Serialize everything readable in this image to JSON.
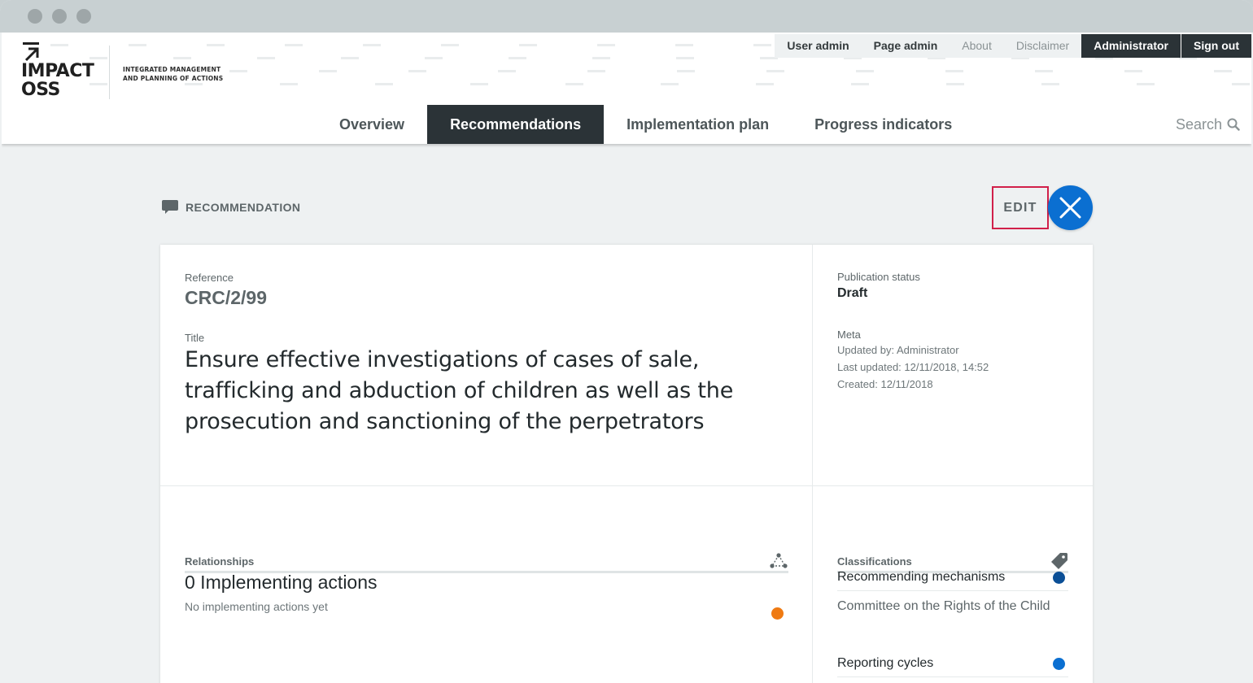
{
  "window": {
    "controls": [
      "close",
      "minimize",
      "maximize"
    ]
  },
  "header": {
    "logo": {
      "name": "IMPACT\nOSS",
      "claim_line1": "INTEGRATED MANAGEMENT",
      "claim_line2": "AND PLANNING OF ACTIONS",
      "icon": "arrow-up-left-icon"
    },
    "topnav": {
      "user_admin": "User admin",
      "page_admin": "Page admin",
      "about": "About",
      "disclaimer": "Disclaimer",
      "account": "Administrator",
      "sign_out": "Sign out"
    },
    "mainnav": {
      "overview": "Overview",
      "recommendations": "Recommendations",
      "implementation_plan": "Implementation plan",
      "progress_indicators": "Progress indicators",
      "active": "Recommendations"
    },
    "search": {
      "label": "Search",
      "icon": "search-icon"
    }
  },
  "page": {
    "type_label": "RECOMMENDATION",
    "type_icon": "comment-icon",
    "edit_label": "EDIT",
    "close_icon": "close-icon"
  },
  "record": {
    "reference_label": "Reference",
    "reference": "CRC/2/99",
    "title_label": "Title",
    "title": "Ensure effective investigations of cases of sale, trafficking and abduction of children as well as the prosecution and sanctioning of the perpetrators",
    "publication_status_label": "Publication status",
    "publication_status": "Draft",
    "meta_label": "Meta",
    "updated_by": "Updated by: Administrator",
    "last_updated": "Last updated: 12/11/2018, 14:52",
    "created": "Created: 12/11/2018"
  },
  "relationships": {
    "label": "Relationships",
    "icon": "network-icon",
    "implementing_actions": "0 Implementing actions",
    "empty_text": "No implementing actions yet",
    "color": "#ef7a12"
  },
  "classifications": {
    "label": "Classifications",
    "icon": "tag-icon",
    "items": [
      {
        "title": "Recommending mechanisms",
        "value": "Committee on the Rights of the Child",
        "color": "#0b4f96"
      },
      {
        "title": "Reporting cycles",
        "color": "#0b6fd1"
      }
    ]
  },
  "colors": {
    "dark_nav": "#2b3337",
    "accent_blue": "#0b6fd1",
    "highlight_border": "#d1204a"
  }
}
